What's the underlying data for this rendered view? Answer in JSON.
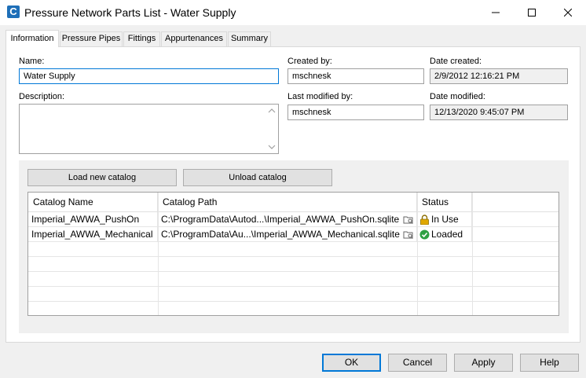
{
  "window": {
    "title": "Pressure Network Parts List - Water Supply",
    "app_icon_letter": "C"
  },
  "tabs": [
    {
      "label": "Information"
    },
    {
      "label": "Pressure Pipes"
    },
    {
      "label": "Fittings"
    },
    {
      "label": "Appurtenances"
    },
    {
      "label": "Summary"
    }
  ],
  "info": {
    "name_label": "Name:",
    "name_value": "Water Supply",
    "description_label": "Description:",
    "description_value": "",
    "created_by_label": "Created by:",
    "created_by_value": "mschnesk",
    "date_created_label": "Date created:",
    "date_created_value": "2/9/2012 12:16:21 PM",
    "last_modified_by_label": "Last modified by:",
    "last_modified_by_value": "mschnesk",
    "date_modified_label": "Date modified:",
    "date_modified_value": "12/13/2020 9:45:07 PM"
  },
  "catalog": {
    "load_button": "Load new catalog",
    "unload_button": "Unload catalog",
    "columns": [
      "Catalog Name",
      "Catalog Path",
      "Status"
    ],
    "rows": [
      {
        "name": "Imperial_AWWA_PushOn",
        "path": "C:\\ProgramData\\Autod...\\Imperial_AWWA_PushOn.sqlite",
        "status": "In Use",
        "status_icon": "lock-icon"
      },
      {
        "name": "Imperial_AWWA_Mechanical",
        "path": "C:\\ProgramData\\Au...\\Imperial_AWWA_Mechanical.sqlite",
        "status": "Loaded",
        "status_icon": "check-circle-icon"
      }
    ]
  },
  "footer": {
    "ok": "OK",
    "cancel": "Cancel",
    "apply": "Apply",
    "help": "Help"
  },
  "colors": {
    "accent": "#0078d7",
    "loaded_green": "#2ea043",
    "lock_gold": "#e0a800"
  }
}
